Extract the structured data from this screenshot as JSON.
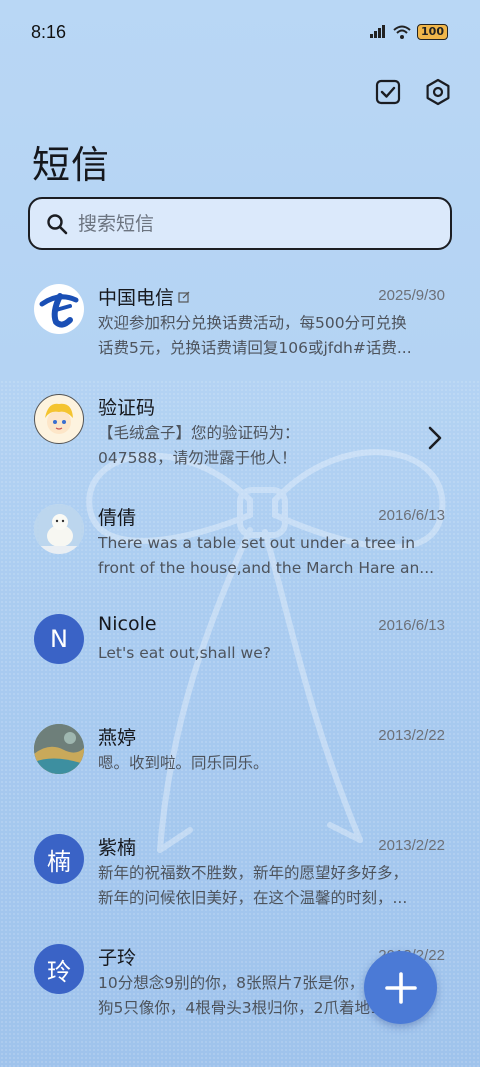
{
  "status_bar": {
    "time": "8:16",
    "battery": "100"
  },
  "header": {
    "title": "短信"
  },
  "search": {
    "placeholder": "搜索短信"
  },
  "conversations": [
    {
      "name": "中国电信",
      "date": "2025/9/30",
      "line1": "欢迎参加积分兑换话费活动，每500分可兑换",
      "line2": "话费5元，兑换话费请回复106或jfdh#话费..."
    },
    {
      "name": "验证码",
      "date": "",
      "line1": "【毛绒盒子】您的验证码为：",
      "line2": "047588，请勿泄露于他人！"
    },
    {
      "name": "倩倩",
      "date": "2016/6/13",
      "line1": "There was a table set out under a tree in",
      "line2": "front of the house,and the March Hare an..."
    },
    {
      "name": "Nicole",
      "date": "2016/6/13",
      "line1": "Let's eat out,shall we?",
      "line2": "",
      "avatar": "N"
    },
    {
      "name": "燕婷",
      "date": "2013/2/22",
      "line1": "嗯。收到啦。同乐同乐。",
      "line2": ""
    },
    {
      "name": "紫楠",
      "date": "2013/2/22",
      "line1": "新年的祝福数不胜数，新年的愿望好多好多，",
      "line2": "新年的问候依旧美好，在这个温馨的时刻，...",
      "avatar": "楠"
    },
    {
      "name": "子玲",
      "date": "2013/2/22",
      "line1": "10分想念9别的你，8张照片7张是你，6只小",
      "line2": "狗5只像你，4根骨头3根归你，2爪着地1定...",
      "avatar": "玲"
    }
  ],
  "colors": {
    "accent": "#3a63c6",
    "fab": "#4b7ad6",
    "background": "#b4d3f3"
  },
  "icons": [
    "signal-icon",
    "wifi-icon",
    "battery-icon",
    "select-checkbox-icon",
    "settings-icon",
    "search-icon",
    "chevron-right-icon",
    "plus-icon",
    "edit-badge-icon"
  ]
}
